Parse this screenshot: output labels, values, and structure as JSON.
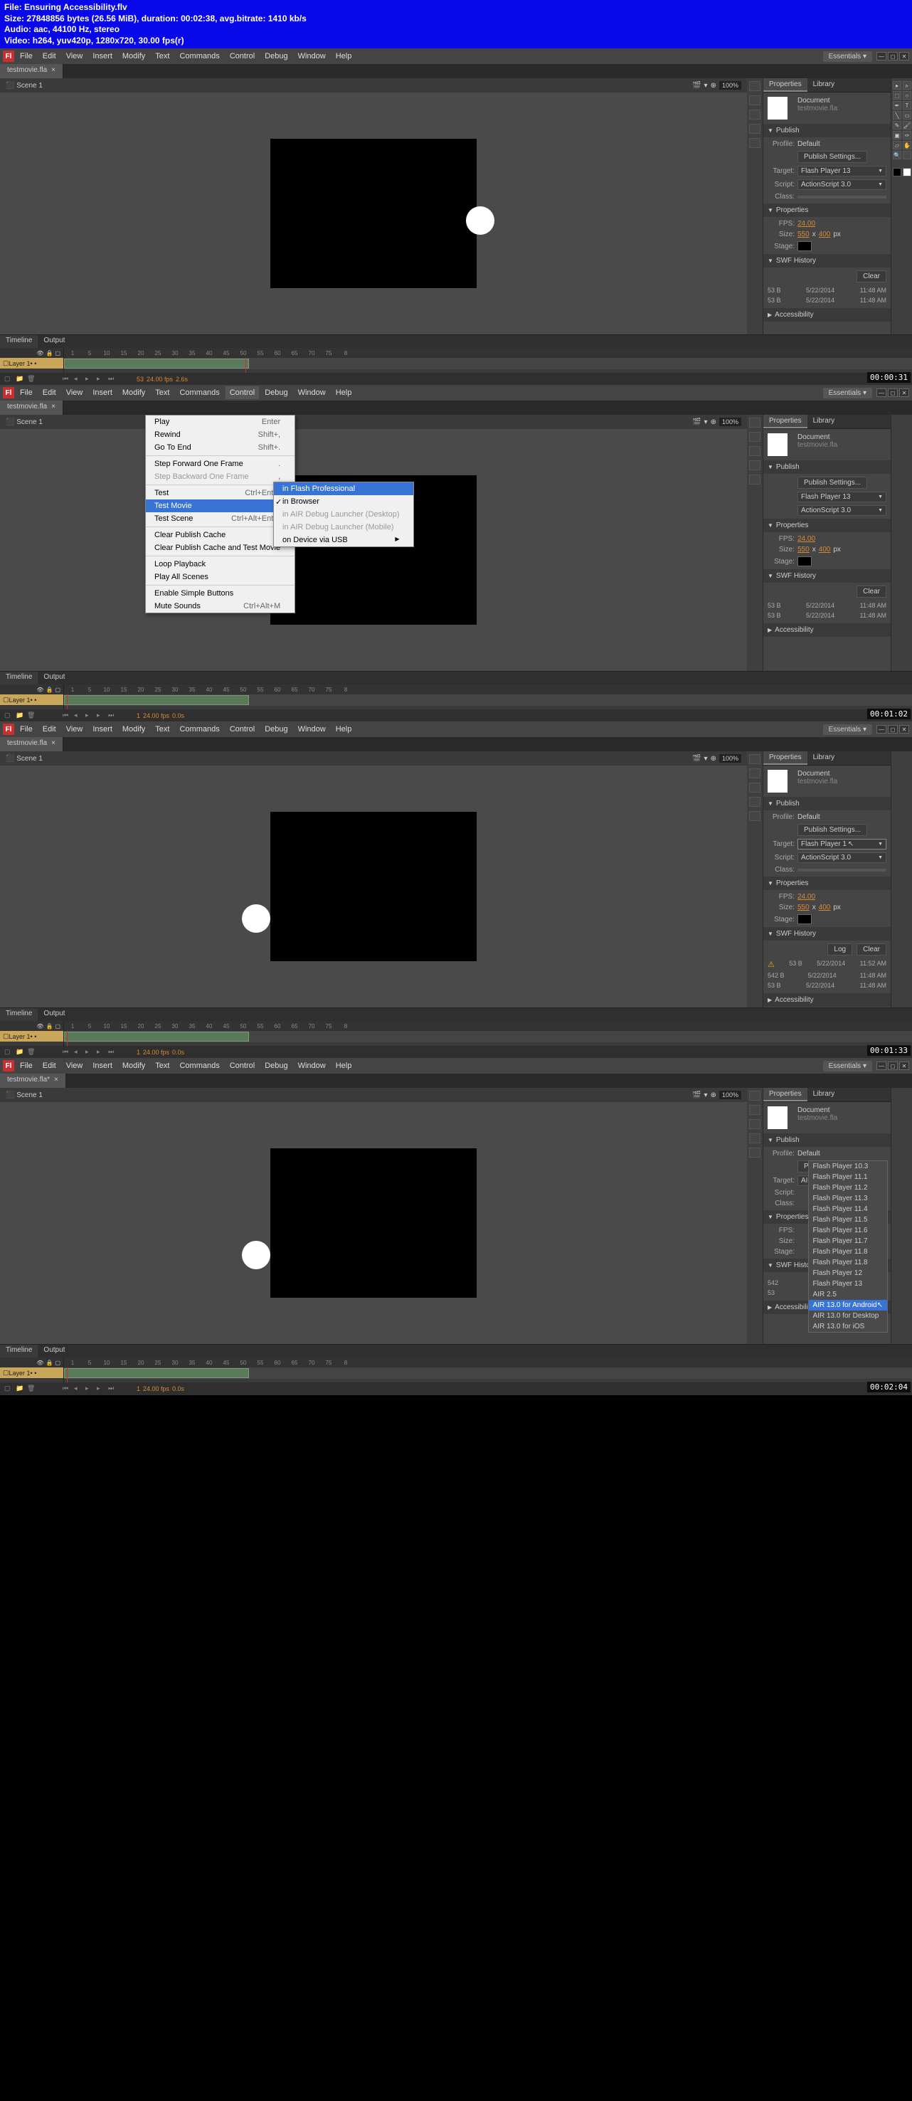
{
  "header": {
    "line1": "File: Ensuring Accessibility.flv",
    "line2": "Size: 27848856 bytes (26.56 MiB), duration: 00:02:38, avg.bitrate: 1410 kb/s",
    "line3": "Audio: aac, 44100 Hz, stereo",
    "line4": "Video: h264, yuv420p, 1280x720, 30.00 fps(r)"
  },
  "menu": [
    "File",
    "Edit",
    "View",
    "Insert",
    "Modify",
    "Text",
    "Commands",
    "Control",
    "Debug",
    "Window",
    "Help"
  ],
  "workspace": "Essentials",
  "file_tab": "testmovie.fla",
  "file_tab_dirty": "testmovie.fla*",
  "scene": "Scene 1",
  "zoom": "100%",
  "panel_tabs": [
    "Properties",
    "Library"
  ],
  "doc": {
    "type": "Document",
    "name": "testmovie.fla"
  },
  "publish": {
    "label": "Publish",
    "profile_label": "Profile:",
    "profile": "Default",
    "settings_btn": "Publish Settings...",
    "target_label": "Target:",
    "target1": "Flash Player 13",
    "target3": "Flash Player 1",
    "target4": "AIR 2.5",
    "script_label": "Script:",
    "script": "ActionScript 3.0",
    "class_label": "Class:"
  },
  "props": {
    "label": "Properties",
    "fps_label": "FPS:",
    "fps": "24.00",
    "size_label": "Size:",
    "w": "550",
    "h": "400",
    "unit": "px",
    "stage_label": "Stage:"
  },
  "hist": {
    "label": "SWF History",
    "log_btn": "Log",
    "clear_btn": "Clear",
    "rows1": [
      {
        "size": "53 B",
        "date": "5/22/2014",
        "time": "11:48 AM"
      },
      {
        "size": "53 B",
        "date": "5/22/2014",
        "time": "11:48 AM"
      }
    ],
    "rows3": [
      {
        "size": "53 B",
        "date": "5/22/2014",
        "time": "11:52 AM",
        "warn": true
      },
      {
        "size": "542 B",
        "date": "5/22/2014",
        "time": "11:48 AM"
      },
      {
        "size": "53 B",
        "date": "5/22/2014",
        "time": "11:48 AM"
      }
    ],
    "rows4": [
      {
        "size": "542",
        "date": "",
        "time": ""
      },
      {
        "size": "53",
        "date": "",
        "time": ""
      }
    ]
  },
  "access": "Accessibility",
  "timeline": {
    "tabs": [
      "Timeline",
      "Output"
    ],
    "layer": "Layer 1",
    "ruler": [
      "1",
      "5",
      "10",
      "15",
      "20",
      "25",
      "30",
      "35",
      "40",
      "45",
      "50",
      "55",
      "60",
      "65",
      "70",
      "75",
      "8"
    ],
    "frame1": "53",
    "frame2": "1",
    "fps_status": "24.00 fps",
    "time1": "2.6s",
    "time2": "0.0s"
  },
  "control_menu": [
    {
      "l": "Play",
      "s": "Enter"
    },
    {
      "l": "Rewind",
      "s": "Shift+,"
    },
    {
      "l": "Go To End",
      "s": "Shift+."
    },
    {
      "sep": true
    },
    {
      "l": "Step Forward One Frame",
      "s": "."
    },
    {
      "l": "Step Backward One Frame",
      "s": ",",
      "disabled": true
    },
    {
      "sep": true
    },
    {
      "l": "Test",
      "s": "Ctrl+Enter"
    },
    {
      "l": "Test Movie",
      "sub": true,
      "hl": true
    },
    {
      "l": "Test Scene",
      "s": "Ctrl+Alt+Enter"
    },
    {
      "sep": true
    },
    {
      "l": "Clear Publish Cache"
    },
    {
      "l": "Clear Publish Cache and Test Movie"
    },
    {
      "sep": true
    },
    {
      "l": "Loop Playback"
    },
    {
      "l": "Play All Scenes"
    },
    {
      "sep": true
    },
    {
      "l": "Enable Simple Buttons"
    },
    {
      "l": "Mute Sounds",
      "s": "Ctrl+Alt+M"
    }
  ],
  "test_submenu": [
    {
      "l": "in Flash Professional",
      "hl": true
    },
    {
      "l": "in Browser",
      "check": true
    },
    {
      "l": "in AIR Debug Launcher (Desktop)",
      "disabled": true
    },
    {
      "l": "in AIR Debug Launcher (Mobile)",
      "disabled": true
    },
    {
      "l": "on Device via USB",
      "sub": true
    }
  ],
  "target_dropdown": [
    "Flash Player 10.3",
    "Flash Player 11.1",
    "Flash Player 11.2",
    "Flash Player 11.3",
    "Flash Player 11.4",
    "Flash Player 11.5",
    "Flash Player 11.6",
    "Flash Player 11.7",
    "Flash Player 11.8",
    "Flash Player 11.8",
    "Flash Player 12",
    "Flash Player 13",
    "AIR 2.5",
    "AIR 13.0 for Android",
    "AIR 13.0 for Desktop",
    "AIR 13.0 for iOS"
  ],
  "timestamps": [
    "00:00:31",
    "00:01:02",
    "00:01:33",
    "00:02:04"
  ]
}
